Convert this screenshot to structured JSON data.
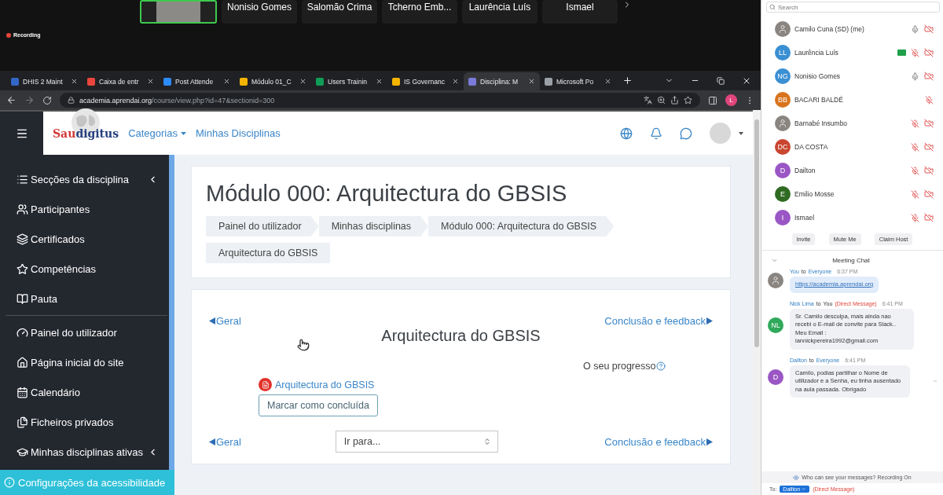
{
  "meeting": {
    "tiles": [
      {
        "kind": "video"
      },
      {
        "kind": "name",
        "name": "Nonisio Gomes"
      },
      {
        "kind": "name",
        "name": "Salomão Crima"
      },
      {
        "kind": "name",
        "name": "Tcherno Emb..."
      },
      {
        "kind": "name",
        "name": "Laurência Luís"
      },
      {
        "kind": "name",
        "name": "Ismael"
      }
    ],
    "recording": "Recording"
  },
  "browser": {
    "tabs": [
      {
        "title": "DHIS 2 Maint",
        "selected": false
      },
      {
        "title": "Caixa de entr",
        "selected": false
      },
      {
        "title": "Post Attende",
        "selected": false
      },
      {
        "title": "Módulo 01_C",
        "selected": false
      },
      {
        "title": "Users Trainin",
        "selected": false
      },
      {
        "title": "IS Governanc",
        "selected": false
      },
      {
        "title": "Disciplina: M",
        "selected": true
      },
      {
        "title": "Microsoft Po",
        "selected": false
      }
    ],
    "url_host": "academia.aprendai.org",
    "url_path": "/course/view.php?id=47&sectionid=300",
    "profile_initial": "L"
  },
  "site": {
    "logo": {
      "part_1": "Sau",
      "part_2": "digitus"
    },
    "nav": [
      {
        "label": "Categorias",
        "dropdown": true
      },
      {
        "label": "Minhas Disciplinas",
        "dropdown": false
      }
    ]
  },
  "sidebar": {
    "groups": [
      [
        {
          "label": "Secções da disciplina",
          "collapsible": true
        },
        {
          "label": "Participantes",
          "collapsible": false
        },
        {
          "label": "Certificados",
          "collapsible": false
        },
        {
          "label": "Competências",
          "collapsible": false
        },
        {
          "label": "Pauta",
          "collapsible": false
        }
      ],
      [
        {
          "label": "Painel do utilizador",
          "collapsible": false
        },
        {
          "label": "Página inicial do site",
          "collapsible": false
        },
        {
          "label": "Calendário",
          "collapsible": false
        },
        {
          "label": "Ficheiros privados",
          "collapsible": false
        },
        {
          "label": "Minhas disciplinas ativas",
          "collapsible": true
        }
      ]
    ],
    "accessibility": "Configurações da acessibilidade"
  },
  "header": {
    "title": "Módulo 000: Arquitectura do GBSIS",
    "breadcrumbs": [
      "Painel do utilizador",
      "Minhas disciplinas",
      "Módulo 000: Arquitectura do GBSIS",
      "Arquitectura do GBSIS"
    ]
  },
  "section": {
    "nav_top": {
      "prev": "Geral",
      "next": "Conclusão e feedback"
    },
    "title": "Arquitectura do GBSIS",
    "progress": "O seu progresso",
    "activity": "Arquitectura do GBSIS",
    "complete_button": "Marcar como concluída",
    "nav_bottom": {
      "prev": "Geral",
      "next": "Conclusão e feedback"
    },
    "jump_select": "Ir para..."
  },
  "participants": {
    "search_placeholder": "Search",
    "list": [
      {
        "name": "Camilo Cuna (SD) (me)",
        "avatar": {
          "kind": "photo"
        },
        "sharing": false,
        "mic_muted": false,
        "camera_off": true
      },
      {
        "name": "Laurência Luís",
        "avatar": {
          "kind": "initials",
          "initials": "LL",
          "color": "#3b8fd3"
        },
        "sharing": true,
        "mic_muted": true,
        "camera_off": true
      },
      {
        "name": "Nonisio Gomes",
        "avatar": {
          "kind": "initials",
          "initials": "NG",
          "color": "#3b8fd3"
        },
        "sharing": false,
        "mic_muted": false,
        "camera_off": true
      },
      {
        "name": "BACARI BALDÉ",
        "avatar": {
          "kind": "initials",
          "initials": "BB",
          "color": "#d9741d"
        },
        "sharing": false,
        "mic_muted": true,
        "camera_off": false
      },
      {
        "name": "Barnabé Insumbo",
        "avatar": {
          "kind": "photo"
        },
        "sharing": false,
        "mic_muted": true,
        "camera_off": true
      },
      {
        "name": "DA COSTA",
        "avatar": {
          "kind": "initials",
          "initials": "DC",
          "color": "#c94630"
        },
        "sharing": false,
        "mic_muted": true,
        "camera_off": true
      },
      {
        "name": "Dailton",
        "avatar": {
          "kind": "initials",
          "initials": "D",
          "color": "#9a56c4"
        },
        "sharing": false,
        "mic_muted": true,
        "camera_off": true
      },
      {
        "name": "Emilio Mosse",
        "avatar": {
          "kind": "initials",
          "initials": "E",
          "color": "#2f6b22"
        },
        "sharing": false,
        "mic_muted": true,
        "camera_off": true
      },
      {
        "name": "Ismael",
        "avatar": {
          "kind": "initials",
          "initials": "I",
          "color": "#9a56c4"
        },
        "sharing": false,
        "mic_muted": true,
        "camera_off": true
      }
    ],
    "buttons": [
      "Invite",
      "Mute Me",
      "Claim Host"
    ]
  },
  "chat": {
    "title": "Meeting Chat",
    "messages": [
      {
        "sender": "You",
        "connector": "to",
        "recipient": "Everyone",
        "time": "6:37 PM",
        "avatar": {
          "kind": "photo"
        },
        "kind": "link",
        "text": "https://academia.aprendai.org"
      },
      {
        "sender": "Nick Lima",
        "connector": "to",
        "recipient": "You",
        "note": "(Direct Message)",
        "time": "6:41 PM",
        "avatar": {
          "kind": "initials",
          "initials": "NL",
          "color": "#2fa95a"
        },
        "kind": "text",
        "text": "Sr. Camilo desculpa, mais ainda nao recebi o E-mail de convite para Slack..\nMeu Email :\niannickpereira1992@gmail.com"
      },
      {
        "sender": "Dailton",
        "connector": "to",
        "recipient": "Everyone",
        "time": "6:41 PM",
        "avatar": {
          "kind": "initials",
          "initials": "D",
          "color": "#9a56c4"
        },
        "kind": "text",
        "text": "Camilo, podias partilhar o Nome de utilizador e a Senha, eu tinha ausentado na aula passada. Obrigado"
      }
    ],
    "notice": "Who can see your messages? Recording On",
    "to_label": "To:",
    "recipient": "Dailton",
    "recipient_note": "(Direct Message)"
  }
}
